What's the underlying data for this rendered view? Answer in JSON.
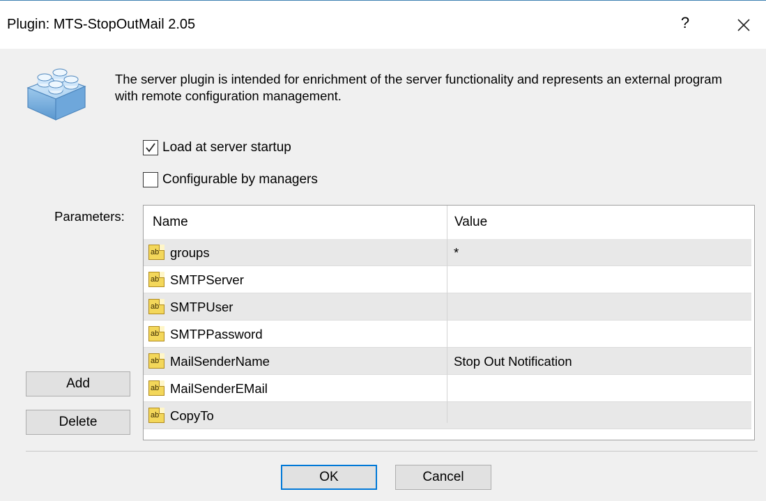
{
  "window": {
    "title": "Plugin: MTS-StopOutMail 2.05",
    "help_label": "?"
  },
  "description": "The server plugin is intended for enrichment of the server functionality and represents an external program with remote configuration management.",
  "options": {
    "load_at_startup": {
      "label": "Load at server startup",
      "checked": true
    },
    "configurable_by_managers": {
      "label": "Configurable by managers",
      "checked": false
    }
  },
  "parameters": {
    "label": "Parameters:",
    "columns": {
      "name": "Name",
      "value": "Value"
    },
    "type_icon_text": "ab",
    "rows": [
      {
        "name": "groups",
        "value": "*"
      },
      {
        "name": "SMTPServer",
        "value": ""
      },
      {
        "name": "SMTPUser",
        "value": ""
      },
      {
        "name": "SMTPPassword",
        "value": ""
      },
      {
        "name": "MailSenderName",
        "value": "Stop Out Notification"
      },
      {
        "name": "MailSenderEMail",
        "value": ""
      },
      {
        "name": "CopyTo",
        "value": ""
      }
    ]
  },
  "buttons": {
    "add": "Add",
    "delete": "Delete",
    "ok": "OK",
    "cancel": "Cancel"
  },
  "colors": {
    "accent": "#0078d7",
    "dialog_bg": "#f0f0f0",
    "row_shade": "#e8e8e8"
  }
}
